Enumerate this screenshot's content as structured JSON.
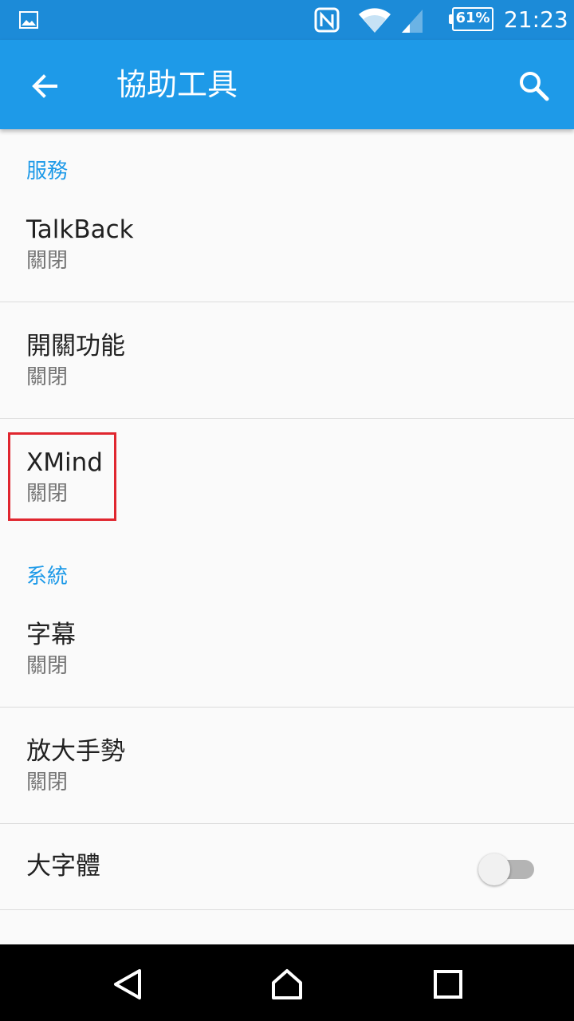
{
  "status_bar": {
    "battery_percent": "61%",
    "time": "21:23",
    "icons": [
      "gallery-notification-icon",
      "nfc-icon",
      "wifi-icon",
      "cellular-signal-icon",
      "battery-icon"
    ]
  },
  "app_bar": {
    "title": "協助工具",
    "icons": [
      "back-arrow-icon",
      "search-icon"
    ]
  },
  "sections": [
    {
      "header": "服務",
      "items": [
        {
          "title": "TalkBack",
          "subtitle": "關閉"
        },
        {
          "title": "開關功能",
          "subtitle": "關閉"
        },
        {
          "title": "XMind",
          "subtitle": "關閉"
        }
      ]
    },
    {
      "header": "系統",
      "items": [
        {
          "title": "字幕",
          "subtitle": "關閉"
        },
        {
          "title": "放大手勢",
          "subtitle": "關閉"
        },
        {
          "title": "大字體",
          "toggle_on": false
        }
      ]
    }
  ],
  "colors": {
    "status_bar": "#1c8bd8",
    "app_bar": "#1e9ae8",
    "accent": "#1e9ae8",
    "highlight_box": "#e0262f"
  },
  "nav_bar": {
    "icons": [
      "back-triangle-icon",
      "home-icon",
      "recents-icon"
    ]
  }
}
